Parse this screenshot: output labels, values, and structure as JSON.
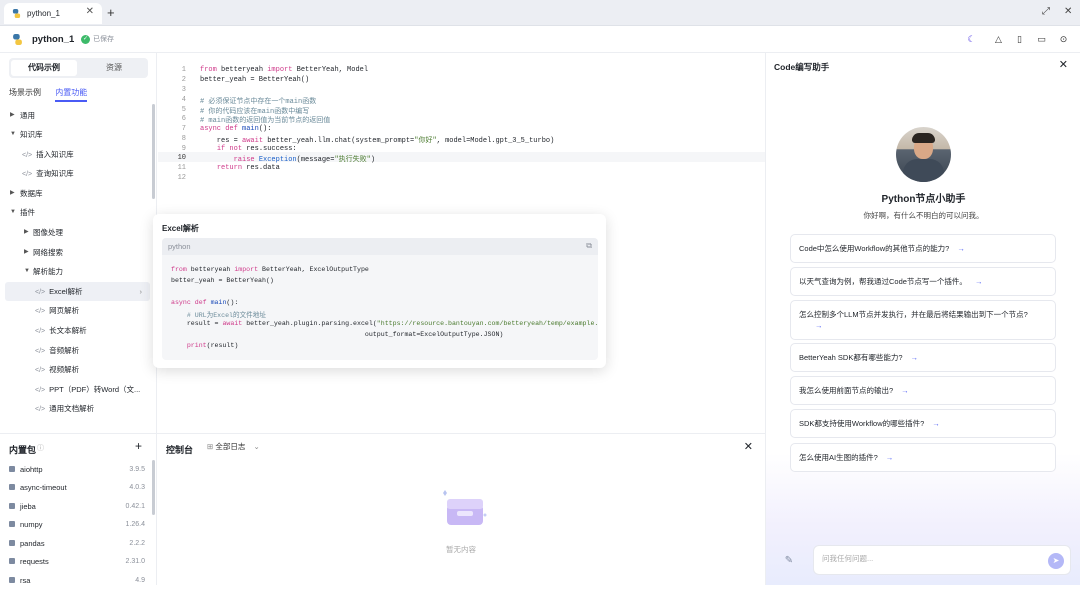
{
  "tabbar": {
    "tab_label": "python_1",
    "close": "✕",
    "new_tab": "+"
  },
  "header": {
    "title": "python_1",
    "saved": "已保存"
  },
  "left": {
    "segment": {
      "active": "代码示例",
      "other": "资源"
    },
    "subtabs": {
      "a": "场景示例",
      "b": "内置功能"
    },
    "tree": [
      {
        "label": "通用"
      },
      {
        "label": "知识库"
      },
      {
        "label": "插入知识库"
      },
      {
        "label": "查询知识库"
      },
      {
        "label": "数据库"
      },
      {
        "label": "插件"
      },
      {
        "label": "图像处理"
      },
      {
        "label": "网络搜索"
      },
      {
        "label": "解析能力"
      },
      {
        "label": "Excel解析"
      },
      {
        "label": "网页解析"
      },
      {
        "label": "长文本解析"
      },
      {
        "label": "音频解析"
      },
      {
        "label": "视频解析"
      },
      {
        "label": "PPT（PDF）转Word（文..."
      },
      {
        "label": "通用文档解析"
      }
    ]
  },
  "packages": {
    "title": "内置包",
    "items": [
      {
        "name": "aiohttp",
        "version": "3.9.5"
      },
      {
        "name": "async-timeout",
        "version": "4.0.3"
      },
      {
        "name": "jieba",
        "version": "0.42.1"
      },
      {
        "name": "numpy",
        "version": "1.26.4"
      },
      {
        "name": "pandas",
        "version": "2.2.2"
      },
      {
        "name": "requests",
        "version": "2.31.0"
      },
      {
        "name": "rsa",
        "version": "4.9"
      }
    ]
  },
  "editor": {
    "line_numbers": [
      "1",
      "2",
      "3",
      "4",
      "5",
      "6",
      "7",
      "8",
      "9",
      "10",
      "11",
      "12"
    ]
  },
  "popup": {
    "title": "Excel解析",
    "lang": "python"
  },
  "console": {
    "title": "控制台",
    "filter": "全部日志",
    "empty": "暂无内容"
  },
  "assistant": {
    "title": "Code编写助手",
    "name": "Python节点小助手",
    "greeting": "你好啊，有什么不明白的可以问我。",
    "questions": [
      "Code中怎么使用Workflow的其他节点的能力?",
      "以天气查询为例，帮我通过Code节点写一个插件。",
      "怎么控制多个LLM节点并发执行，并在最后将结果输出到下一个节点?",
      "BetterYeah SDK都有哪些能力?",
      "我怎么使用前面节点的输出?",
      "SDK都支持使用Workflow的哪些插件?",
      "怎么使用AI生图的插件?"
    ],
    "input_placeholder": "问我任何问题..."
  }
}
